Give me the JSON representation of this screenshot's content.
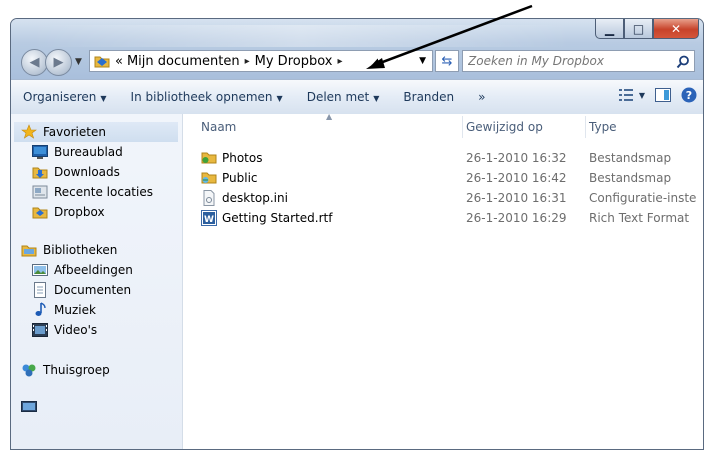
{
  "window": {
    "caption_buttons": {
      "minimize": "▁",
      "maximize": "□",
      "close": "✕"
    }
  },
  "address_bar": {
    "overflow": "«",
    "crumbs": [
      "Mijn documenten",
      "My Dropbox"
    ],
    "separator": "▸"
  },
  "search": {
    "placeholder": "Zoeken in My Dropbox"
  },
  "toolbar": {
    "organize": "Organiseren",
    "include_library": "In bibliotheek opnemen",
    "share_with": "Delen met",
    "burn": "Branden",
    "more": "»"
  },
  "nav_pane": {
    "favorites": {
      "header": "Favorieten",
      "items": [
        "Bureaublad",
        "Downloads",
        "Recente locaties",
        "Dropbox"
      ]
    },
    "libraries": {
      "header": "Bibliotheken",
      "items": [
        "Afbeeldingen",
        "Documenten",
        "Muziek",
        "Video's"
      ]
    },
    "homegroup": {
      "header": "Thuisgroep"
    }
  },
  "columns": {
    "name": "Naam",
    "modified": "Gewijzigd op",
    "type": "Type"
  },
  "files": [
    {
      "name": "Photos",
      "modified": "26-1-2010 16:32",
      "type": "Bestandsmap",
      "icon": "shared-folder-icon"
    },
    {
      "name": "Public",
      "modified": "26-1-2010 16:42",
      "type": "Bestandsmap",
      "icon": "public-folder-icon"
    },
    {
      "name": "desktop.ini",
      "modified": "26-1-2010 16:31",
      "type": "Configuratie-inste...",
      "icon": "ini-file-icon"
    },
    {
      "name": "Getting Started.rtf",
      "modified": "26-1-2010 16:29",
      "type": "Rich Text Format",
      "icon": "rtf-file-icon"
    }
  ],
  "colors": {
    "toolbar_text": "#1e395b",
    "close_button": "#c7432a",
    "annotation_arrow": "#000000"
  }
}
